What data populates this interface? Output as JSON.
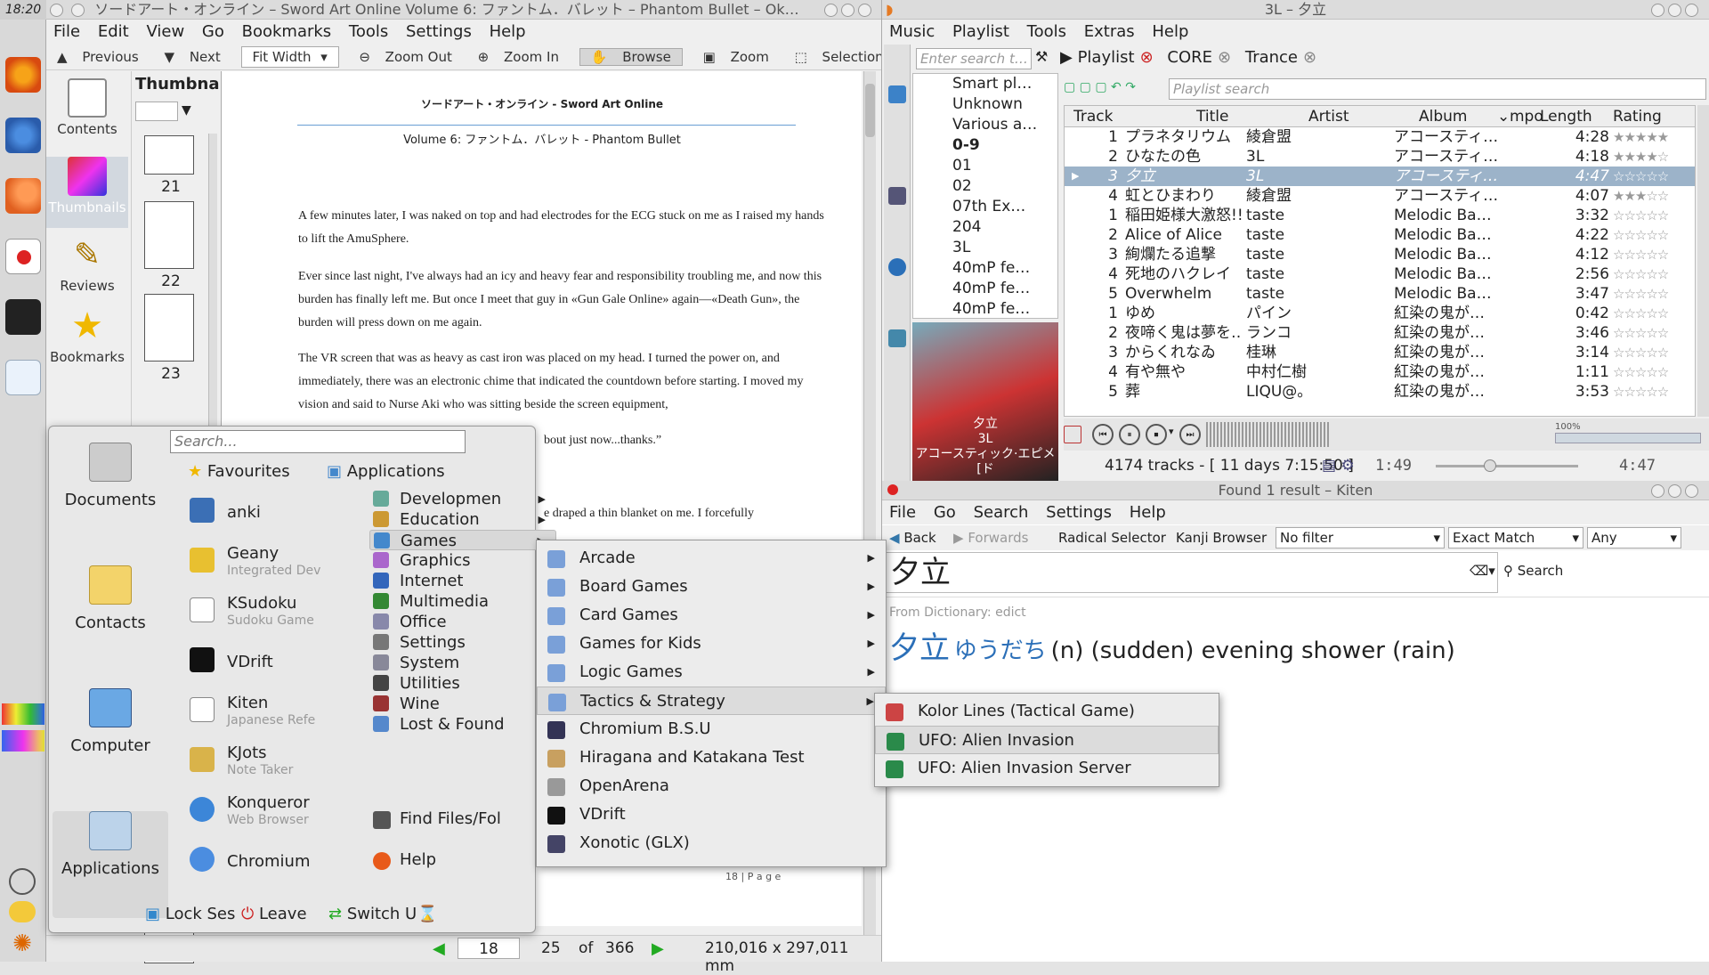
{
  "panel": {
    "clock": "18:20"
  },
  "okular": {
    "title": "ソードアート・オンライン – Sword Art Online Volume 6: ファントム．バレット – Phantom Bullet – Ok…",
    "menu": [
      "File",
      "Edit",
      "View",
      "Go",
      "Bookmarks",
      "Tools",
      "Settings",
      "Help"
    ],
    "toolbar": {
      "previous": "Previous",
      "next": "Next",
      "fit": "Fit Width",
      "zoom_out": "Zoom Out",
      "zoom_in": "Zoom In",
      "browse": "Browse",
      "zoom": "Zoom",
      "selection": "Selection"
    },
    "sidebar": [
      "Contents",
      "Thumbnails",
      "Reviews",
      "Bookmarks"
    ],
    "thumbs_title": "Thumbna",
    "thumb_pages": [
      "21",
      "22",
      "23"
    ],
    "page": {
      "header": "ソードアート・オンライン - Sword Art Online",
      "subheader": "Volume 6: ファントム．バレット - Phantom Bullet",
      "p1": "A few minutes later, I was naked on top and had electrodes for the ECG stuck on me as I raised my hands to lift the AmuSphere.",
      "p2": "Ever since last night, I've always had an icy and heavy fear and responsibility troubling me, and now this burden has finally left me. But once I meet that guy in «Gun Gale Online» again—«Death Gun», the burden will press down on me again.",
      "p3": "The VR screen that was as heavy as cast iron was placed on my head. I turned the power on, and immediately, there was an electronic chime that indicated the countdown before starting. I moved my vision and said to Nurse Aki who was sitting beside the screen equipment,",
      "p4": "bout just now...thanks.”",
      "p5": "e draped a thin blanket on me. I forcefully",
      "footer": "18 | P a g e"
    },
    "status": {
      "page": "18",
      "count": "25",
      "of": "of",
      "total": "366",
      "size": "210,016 x 297,011 mm"
    }
  },
  "amarok": {
    "title": "3L – 夕立",
    "menu": [
      "Music",
      "Playlist",
      "Tools",
      "Extras",
      "Help"
    ],
    "search_placeholder": "Enter search t…",
    "collection": [
      "Smart pl…",
      "Unknown",
      "Various a…",
      "0-9",
      "01",
      "02",
      "07th Ex…",
      "204",
      "3L",
      "40mP fe…",
      "40mP fe…",
      "40mP fe…"
    ],
    "tabs": [
      "Playlist",
      "CORE",
      "Trance"
    ],
    "playlist_search": "Playlist search",
    "columns": [
      "Track",
      "Title",
      "Artist",
      "Album",
      "mpo",
      "Length",
      "Rating"
    ],
    "rows": [
      {
        "track": "1",
        "title": "プラネタリウム",
        "artist": "綾倉盟",
        "album": "アコースティ…",
        "length": "4:28",
        "rating": "★★★★★"
      },
      {
        "track": "2",
        "title": "ひなたの色",
        "artist": "3L",
        "album": "アコースティ…",
        "length": "4:18",
        "rating": "★★★★☆"
      },
      {
        "track": "3",
        "title": "夕立",
        "artist": "3L",
        "album": "アコースティ…",
        "length": "4:47",
        "rating": "☆☆☆☆☆"
      },
      {
        "track": "4",
        "title": "虹とひまわり",
        "artist": "綾倉盟",
        "album": "アコースティ…",
        "length": "4:07",
        "rating": "★★★☆☆"
      },
      {
        "track": "1",
        "title": "稲田姫様大激怒!!",
        "artist": "taste",
        "album": "Melodic Ba…",
        "length": "3:32",
        "rating": "☆☆☆☆☆"
      },
      {
        "track": "2",
        "title": "Alice of Alice",
        "artist": "taste",
        "album": "Melodic Ba…",
        "length": "4:22",
        "rating": "☆☆☆☆☆"
      },
      {
        "track": "3",
        "title": "絢爛たる追撃",
        "artist": "taste",
        "album": "Melodic Ba…",
        "length": "4:12",
        "rating": "☆☆☆☆☆"
      },
      {
        "track": "4",
        "title": "死地のハクレイ",
        "artist": "taste",
        "album": "Melodic Ba…",
        "length": "2:56",
        "rating": "☆☆☆☆☆"
      },
      {
        "track": "5",
        "title": "Overwhelm",
        "artist": "taste",
        "album": "Melodic Ba…",
        "length": "3:47",
        "rating": "☆☆☆☆☆"
      },
      {
        "track": "1",
        "title": "ゆめ",
        "artist": "パイン",
        "album": "紅染の鬼が…",
        "length": "0:42",
        "rating": "☆☆☆☆☆"
      },
      {
        "track": "2",
        "title": "夜啼く鬼は夢を…",
        "artist": "ランコ",
        "album": "紅染の鬼が…",
        "length": "3:46",
        "rating": "☆☆☆☆☆"
      },
      {
        "track": "3",
        "title": "からくれなゐ",
        "artist": "桂琳",
        "album": "紅染の鬼が…",
        "length": "3:14",
        "rating": "☆☆☆☆☆"
      },
      {
        "track": "4",
        "title": "有や無や",
        "artist": "中村仁樹",
        "album": "紅染の鬼が…",
        "length": "1:11",
        "rating": "☆☆☆☆☆"
      },
      {
        "track": "5",
        "title": "葬",
        "artist": "LIQU@。",
        "album": "紅染の鬼が…",
        "length": "3:53",
        "rating": "☆☆☆☆☆"
      }
    ],
    "now_playing": {
      "title": "夕立",
      "artist": "3L",
      "album": "アコースティック·エピメ[ド"
    },
    "volume": "100%",
    "stats": "4174 tracks - [ 11 days 7:15:50 ]",
    "elapsed": "1:49",
    "remaining": "4:47",
    "progress": 0.38
  },
  "kiten": {
    "title": "Found 1 result – Kiten",
    "menu": [
      "File",
      "Go",
      "Search",
      "Settings",
      "Help"
    ],
    "toolbar": {
      "back": "Back",
      "forwards": "Forwards",
      "radical": "Radical Selector",
      "kanji": "Kanji Browser",
      "filter": "No filter",
      "match": "Exact Match",
      "any": "Any"
    },
    "query": "夕立",
    "search_btn": "Search",
    "dict": "From Dictionary: edict",
    "result": {
      "word": "夕立",
      "reading": "ゆうだち",
      "meaning": "(n) (sudden) evening shower (rain)"
    }
  },
  "kickoff": {
    "search_placeholder": "Search...",
    "places": [
      "Documents",
      "Contacts",
      "Computer",
      "Applications"
    ],
    "favourites_header": "Favourites",
    "applications_header": "Applications",
    "favourites": [
      {
        "name": "anki",
        "desc": ""
      },
      {
        "name": "Geany",
        "desc": "Integrated Dev"
      },
      {
        "name": "KSudoku",
        "desc": "Sudoku Game"
      },
      {
        "name": "VDrift",
        "desc": ""
      },
      {
        "name": "Kiten",
        "desc": "Japanese Refe"
      },
      {
        "name": "KJots",
        "desc": "Note Taker"
      },
      {
        "name": "Konqueror",
        "desc": "Web Browser"
      },
      {
        "name": "Chromium",
        "desc": ""
      }
    ],
    "categories": [
      "Developmen",
      "Education",
      "Games",
      "Graphics",
      "Internet",
      "Multimedia",
      "Office",
      "Settings",
      "System",
      "Utilities",
      "Wine",
      "Lost & Found"
    ],
    "find": "Find Files/Fol",
    "help": "Help",
    "bottom": {
      "lock": "Lock Ses",
      "leave": "Leave",
      "switch": "Switch U"
    },
    "games": [
      "Arcade",
      "Board Games",
      "Card Games",
      "Games for Kids",
      "Logic Games",
      "Tactics & Strategy",
      "Chromium B.S.U",
      "Hiragana and Katakana Test",
      "OpenArena",
      "VDrift",
      "Xonotic (GLX)"
    ],
    "tactics": [
      "Kolor Lines (Tactical Game)",
      "UFO: Alien Invasion",
      "UFO: Alien Invasion Server"
    ]
  }
}
